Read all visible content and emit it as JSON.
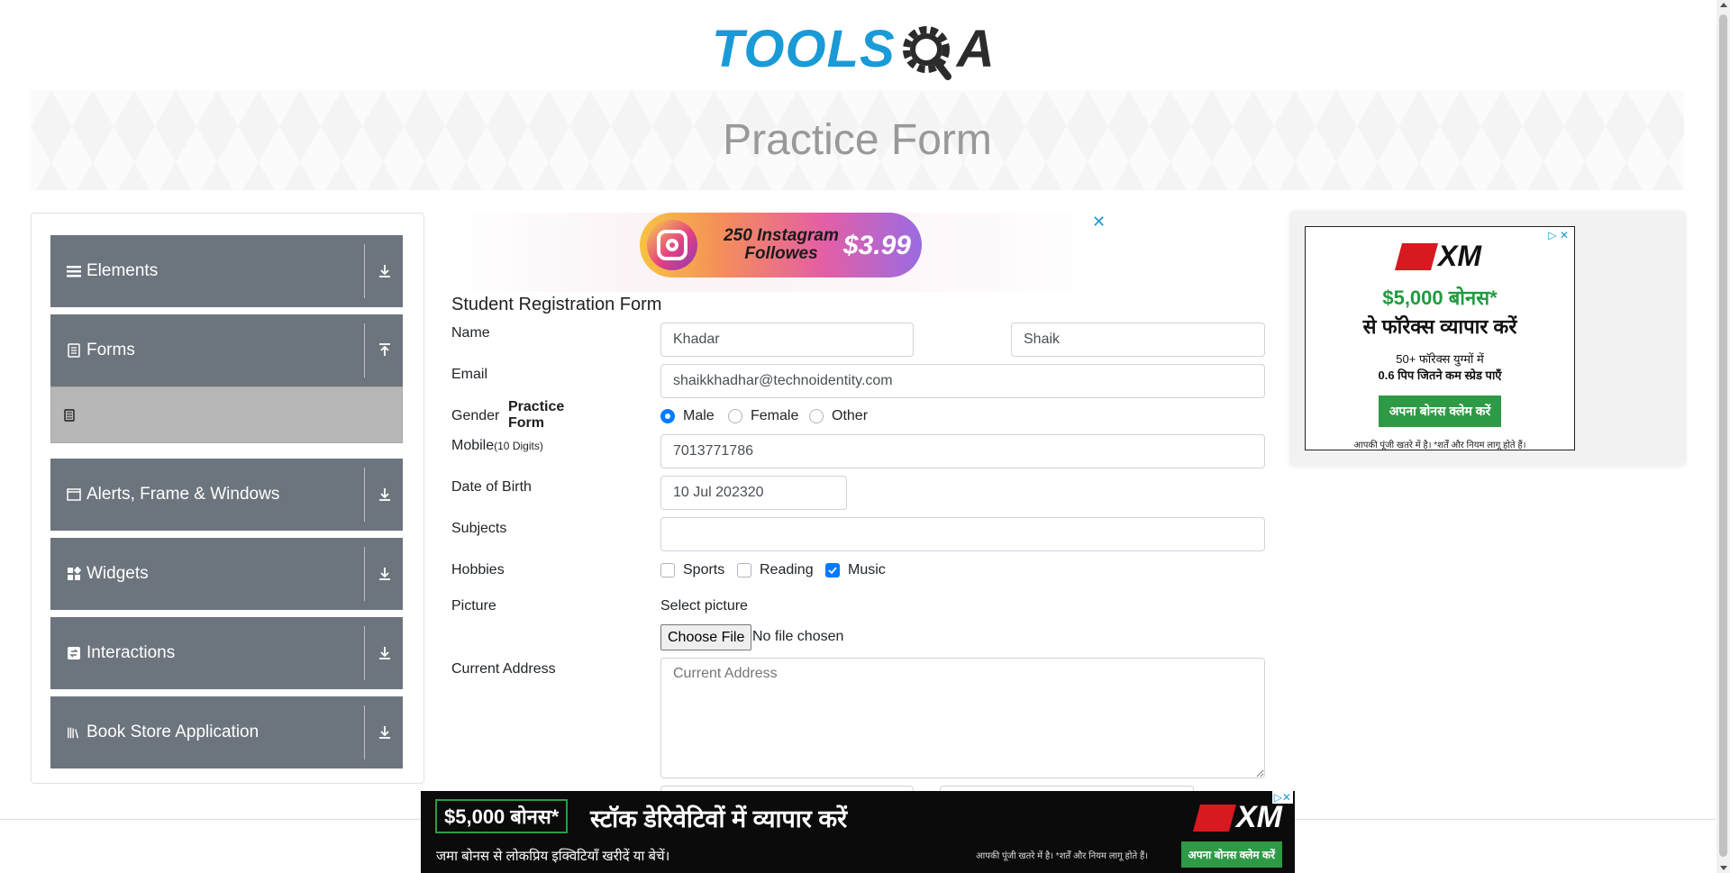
{
  "logo": {
    "text_left": "TOOLS",
    "text_right": "A"
  },
  "banner": {
    "title": "Practice Form"
  },
  "sidebar": {
    "groups": [
      {
        "label": "Elements",
        "icon": "list-icon",
        "expanded": false
      },
      {
        "label": "Forms",
        "icon": "form-icon",
        "expanded": true
      },
      {
        "label": "Alerts, Frame & Windows",
        "icon": "window-icon",
        "expanded": false
      },
      {
        "label": "Widgets",
        "icon": "widgets-icon",
        "expanded": false
      },
      {
        "label": "Interactions",
        "icon": "interactions-icon",
        "expanded": false
      },
      {
        "label": "Book Store Application",
        "icon": "books-icon",
        "expanded": false
      }
    ],
    "active_item": "Practice Form"
  },
  "top_ad": {
    "line1": "250 Instagram",
    "line2": "Followes",
    "price": "$3.99",
    "close": "✕"
  },
  "form": {
    "title": "Student Registration Form",
    "name_label": "Name",
    "first_name": "Khadar",
    "last_name": "Shaik",
    "email_label": "Email",
    "email": "shaikkhadhar@technoidentity.com",
    "gender_label": "Gender",
    "gender_options": [
      "Male",
      "Female",
      "Other"
    ],
    "gender_selected": "Male",
    "mobile_label": "Mobile",
    "mobile_hint": "(10 Digits)",
    "mobile": "7013771786",
    "dob_label": "Date of Birth",
    "dob": "10 Jul 202320",
    "subjects_label": "Subjects",
    "subjects": "",
    "hobbies_label": "Hobbies",
    "hobbies": [
      {
        "label": "Sports",
        "checked": false
      },
      {
        "label": "Reading",
        "checked": false
      },
      {
        "label": "Music",
        "checked": true
      }
    ],
    "picture_label": "Picture",
    "select_picture": "Select picture",
    "choose_file": "Choose File",
    "no_file": "No file chosen",
    "address_label": "Current Address",
    "address_placeholder": "Current Address"
  },
  "right_ad": {
    "brand": "XM",
    "bonus": "$5,000 बोनस*",
    "line2": "से फॉरेक्स व्यापार करें",
    "line3": "50+ फॉरेक्स युग्मों में",
    "line4": "0.6 पिप जितने कम स्प्रेड पाएँ",
    "cta": "अपना बोनस क्लेम करें",
    "footer": "आपकी पूंजी खतरे में है। *शर्तें और नियम लागू होते हैं।"
  },
  "bottom_ad": {
    "bonus": "$5,000 बोनस*",
    "headline": "स्टॉक डेरिवेटिवों में व्यापार करें",
    "sub": "जमा बोनस से लोकप्रिय इक्विटियाँ खरीदें या बेचें।",
    "risk": "आपकी पूंजी खतरे में है। *शर्तें और नियम लागू होते हैं।",
    "brand": "XM",
    "cta": "अपना बोनस क्लेम करें"
  },
  "colors": {
    "accent": "#007bff",
    "sidebar_bg": "#6c757d",
    "active_item_bg": "#b7b7b7",
    "cta_green": "#2e9a45",
    "brand_blue": "#1a9ad6"
  }
}
